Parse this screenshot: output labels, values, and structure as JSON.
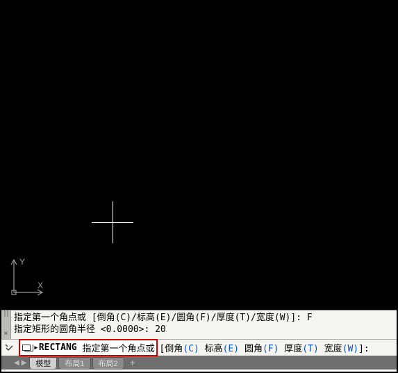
{
  "ucs": {
    "x_label": "X",
    "y_label": "Y"
  },
  "command_history": {
    "line1_prefix": "指定第一个角点或 [",
    "line1_opts": "倒角(C)/标高(E)/圆角(F)/厚度(T)/宽度(W)",
    "line1_suffix": "]: F",
    "line2": "指定矩形的圆角半径 <0.0000>: 20"
  },
  "command_input": {
    "cmd": "RECTANG",
    "prompt": "指定第一个角点或",
    "opt_open": " [",
    "o1_label": "倒角",
    "o1_key": "(C)",
    "sep": " ",
    "o2_label": "标高",
    "o2_key": "(E)",
    "o3_label": "圆角",
    "o3_key": "(F)",
    "o4_label": "厚度",
    "o4_key": "(T)",
    "o5_label": "宽度",
    "o5_key": "(W)",
    "opt_close": "]:"
  },
  "tabs": {
    "model": "模型",
    "layout1": "布局1",
    "layout2": "布局2",
    "add": "+"
  },
  "icons": {
    "close": "×",
    "grip": "┋┋"
  }
}
